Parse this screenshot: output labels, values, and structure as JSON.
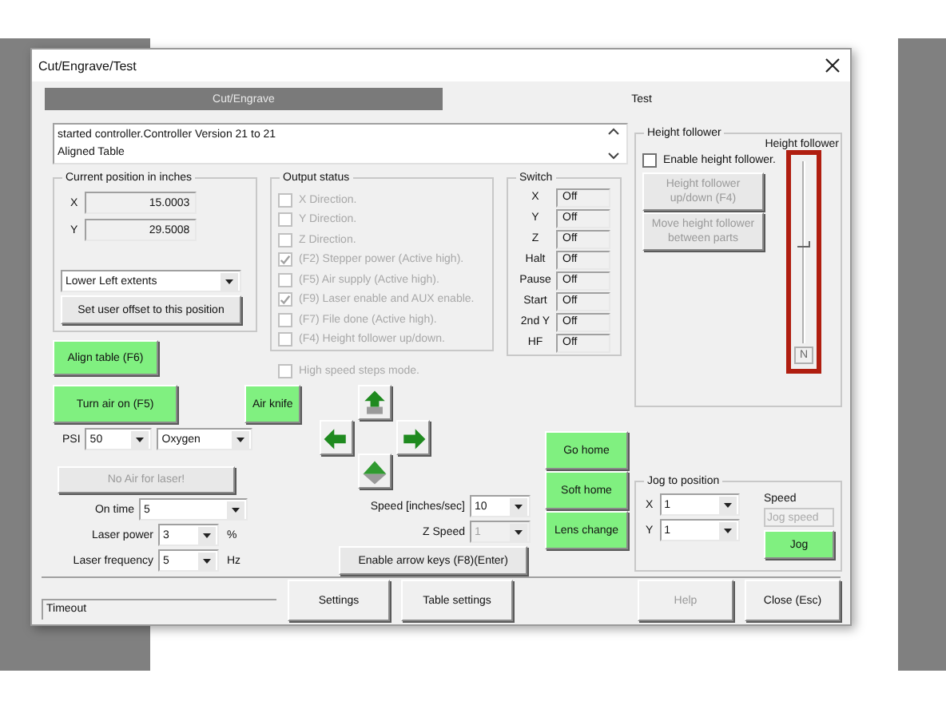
{
  "window": {
    "title": "Cut/Engrave/Test"
  },
  "tabs": [
    {
      "label": "Cut/Engrave",
      "selected": true
    },
    {
      "label": "Test",
      "selected": false
    }
  ],
  "log": {
    "lines": [
      "started controller.Controller Version 21 to 21",
      "Aligned Table"
    ]
  },
  "position": {
    "title": "Current position in inches",
    "fields": [
      {
        "label": "X",
        "value": "15.0003"
      },
      {
        "label": "Y",
        "value": "29.5008"
      }
    ],
    "origin": "Lower Left extents",
    "offset_button": "Set user offset to this position"
  },
  "output_status": {
    "title": "Output status",
    "items": [
      {
        "label": "X Direction.",
        "checked": false,
        "disabled": true
      },
      {
        "label": "Y Direction.",
        "checked": false,
        "disabled": true
      },
      {
        "label": "Z Direction.",
        "checked": false,
        "disabled": true
      },
      {
        "label": "(F2) Stepper power (Active high).",
        "checked": true,
        "disabled": true
      },
      {
        "label": "(F5) Air supply (Active high).",
        "checked": false,
        "disabled": true
      },
      {
        "label": "(F9) Laser enable and AUX enable.",
        "checked": true,
        "disabled": true
      },
      {
        "label": "(F7) File done (Active high).",
        "checked": false,
        "disabled": true
      },
      {
        "label": "(F4) Height follower up/down.",
        "checked": false,
        "disabled": true
      }
    ],
    "high_speed": {
      "label": "High speed steps mode.",
      "checked": false,
      "disabled": true
    }
  },
  "switch": {
    "title": "Switch",
    "rows": [
      {
        "label": "X",
        "value": "Off"
      },
      {
        "label": "Y",
        "value": "Off"
      },
      {
        "label": "Z",
        "value": "Off"
      },
      {
        "label": "Halt",
        "value": "Off"
      },
      {
        "label": "Pause",
        "value": "Off"
      },
      {
        "label": "Start",
        "value": "Off"
      },
      {
        "label": "2nd Y",
        "value": "Off"
      },
      {
        "label": "HF",
        "value": "Off"
      }
    ]
  },
  "air": {
    "align_button": "Align table (F6)",
    "air_button": "Turn air on (F5)",
    "knife_button": "Air knife",
    "psi_label": "PSI",
    "psi": "50",
    "gas": "Oxygen",
    "no_air_button": {
      "label": "No Air for laser!",
      "disabled": true
    }
  },
  "laser": [
    {
      "label": "On time",
      "value": "5"
    },
    {
      "label": "Laser power",
      "value": "3",
      "unit": "%"
    },
    {
      "label": "Laser frequency",
      "value": "5",
      "unit": "Hz"
    }
  ],
  "motion": {
    "speed_label": "Speed [inches/sec]",
    "speed": "10",
    "z_label": "Z Speed",
    "z_speed": {
      "value": "1",
      "disabled": true
    },
    "arrow_keys_button": "Enable arrow keys (F8)(Enter)"
  },
  "home_buttons": [
    "Go home",
    "Soft home",
    "Lens change"
  ],
  "height_follower": {
    "title": "Height follower",
    "enable": {
      "label": "Enable height follower.",
      "checked": false
    },
    "buttons": [
      {
        "label": "Height follower up/down (F4)",
        "disabled": true
      },
      {
        "label": "Move height follower between parts",
        "disabled": true
      }
    ],
    "slider": {
      "label": "Height follower",
      "level": 0.54,
      "end_label": "N",
      "highlighted": true
    }
  },
  "jog": {
    "title": "Jog to position",
    "fields": [
      {
        "label": "X",
        "value": "1"
      },
      {
        "label": "Y",
        "value": "1"
      }
    ],
    "speed_label": "Speed",
    "speed": {
      "placeholder": "Jog speed",
      "disabled": true
    },
    "button": "Jog"
  },
  "status": {
    "text": "Timeout"
  },
  "footer": {
    "left": [
      {
        "label": "Settings",
        "disabled": false
      },
      {
        "label": "Table settings",
        "disabled": false
      }
    ],
    "right": [
      {
        "label": "Help",
        "disabled": true
      },
      {
        "label": "Close (Esc)",
        "disabled": false
      }
    ]
  }
}
